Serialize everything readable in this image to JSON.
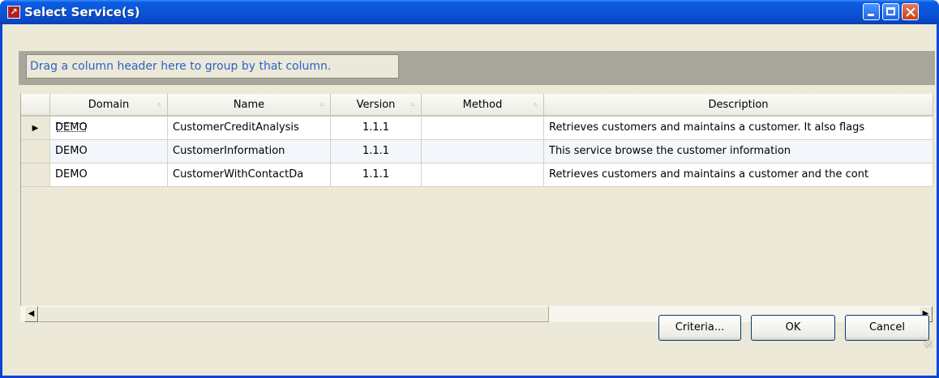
{
  "window": {
    "title": "Select Service(s)",
    "icon": "app-icon",
    "controls": [
      "minimize-icon",
      "maximize-icon",
      "close-icon"
    ],
    "accent": "#0a55d8"
  },
  "group_panel": {
    "hint": "Drag a column header here to group by that column."
  },
  "grid": {
    "columns": [
      "Domain",
      "Name",
      "Version",
      "Method",
      "Description"
    ],
    "rows": [
      {
        "domain": "DEMO",
        "name": "CustomerCreditAnalysis",
        "version": "1.1.1",
        "method": "",
        "description": "Retrieves customers and maintains a customer. It also flags"
      },
      {
        "domain": "DEMO",
        "name": "CustomerInformation",
        "version": "1.1.1",
        "method": "",
        "description": "This service browse the customer information"
      },
      {
        "domain": "DEMO",
        "name": "CustomerWithContactDa",
        "version": "1.1.1",
        "method": "",
        "description": "Retrieves customers and maintains a customer and the cont"
      }
    ],
    "current_row_indicator": "▶",
    "sort_glyph": "▵"
  },
  "buttons": {
    "criteria": "Criteria...",
    "ok": "OK",
    "cancel": "Cancel"
  },
  "scrollbar": {
    "left_arrow": "◀",
    "right_arrow": "▶"
  }
}
